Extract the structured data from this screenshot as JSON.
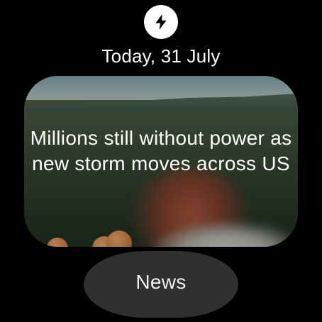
{
  "app": {
    "icon": "lightning-bolt-icon"
  },
  "header": {
    "date": "Today, 31 July"
  },
  "card": {
    "headline": "Millions still without power as new storm moves across US"
  },
  "chip": {
    "label": "News"
  },
  "colors": {
    "background": "#000000",
    "icon_bg": "#ffffff",
    "chip_bg": "#303030",
    "text": "#ffffff"
  }
}
